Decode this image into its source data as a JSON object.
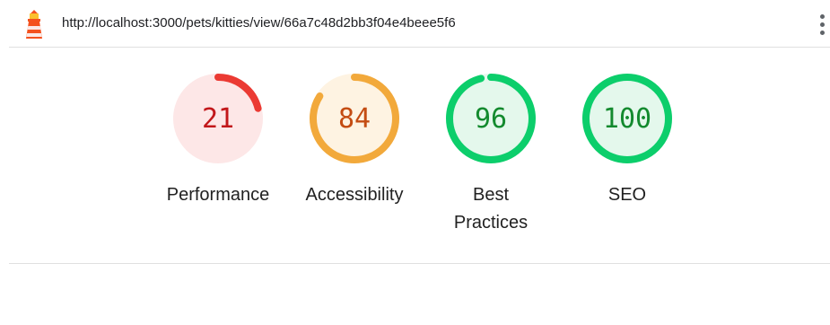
{
  "header": {
    "url": "http://localhost:3000/pets/kitties/view/66a7c48d2bb3f04e4beee5f6",
    "logo_icon": "lighthouse-icon",
    "menu_icon": "more-vert-icon"
  },
  "colors": {
    "fail": "#eb3a33",
    "fail_bg": "#fde7e7",
    "fail_text": "#c2171a",
    "average": "#f2a93b",
    "average_bg": "#fef3e2",
    "average_text": "#c44c12",
    "pass": "#0cce6b",
    "pass_bg": "#e4f8ec",
    "pass_text": "#138a2e"
  },
  "gauges": [
    {
      "score": "21",
      "label_line1": "Performance",
      "label_line2": "",
      "rating": "fail"
    },
    {
      "score": "84",
      "label_line1": "Accessibility",
      "label_line2": "",
      "rating": "average"
    },
    {
      "score": "96",
      "label_line1": "Best",
      "label_line2": "Practices",
      "rating": "pass"
    },
    {
      "score": "100",
      "label_line1": "SEO",
      "label_line2": "",
      "rating": "pass"
    }
  ]
}
